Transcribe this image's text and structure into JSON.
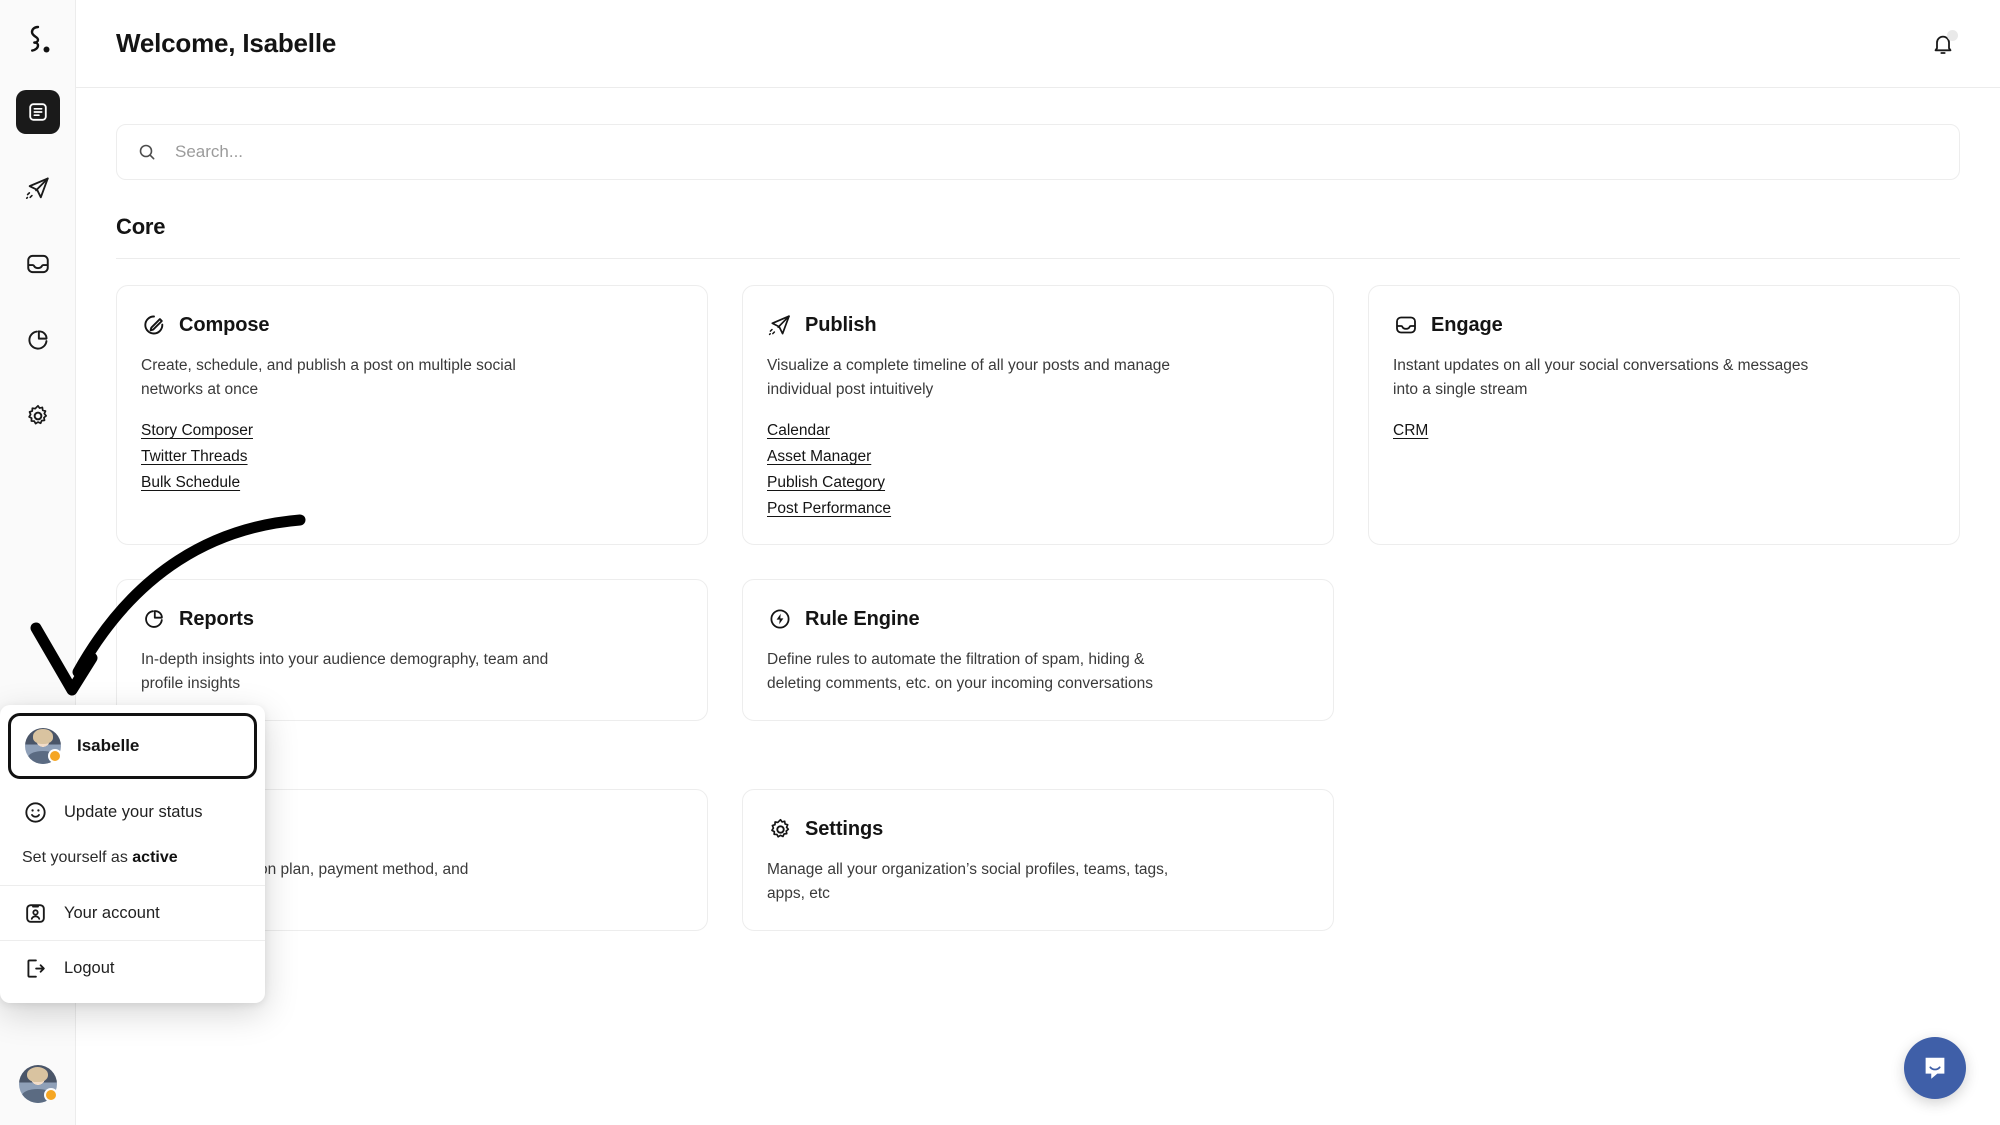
{
  "app": {
    "brand_logo": "contentstudio-logo-icon",
    "accent_color": "#3f5fa8",
    "active_nav_bg": "#1a1a1a"
  },
  "sidebar": {
    "items": [
      {
        "name": "dashboard",
        "icon": "dashboard-icon",
        "active": true
      },
      {
        "name": "publish",
        "icon": "paper-plane-icon",
        "active": false
      },
      {
        "name": "engage",
        "icon": "inbox-icon",
        "active": false
      },
      {
        "name": "reports",
        "icon": "pie-chart-icon",
        "active": false
      },
      {
        "name": "settings",
        "icon": "gear-icon",
        "active": false
      }
    ],
    "avatar_alt": "Isabelle"
  },
  "header": {
    "title": "Welcome, Isabelle",
    "notification_icon": "bell-icon"
  },
  "search": {
    "placeholder": "Search...",
    "value": "",
    "icon": "search-icon"
  },
  "sections": [
    {
      "title": "Core",
      "cards": [
        {
          "icon": "compose-pencil-icon",
          "title": "Compose",
          "description": "Create, schedule, and publish a post on multiple social networks at once",
          "links": [
            "Story Composer",
            "Twitter Threads",
            "Bulk Schedule"
          ]
        },
        {
          "icon": "paper-plane-icon",
          "title": "Publish",
          "description": "Visualize a complete timeline of all your posts and manage individual post intuitively",
          "links": [
            "Calendar",
            "Asset Manager",
            "Publish Category",
            "Post Performance"
          ]
        },
        {
          "icon": "inbox-icon",
          "title": "Engage",
          "description": "Instant updates on all your social conversations & messages into a single stream",
          "links": [
            "CRM"
          ]
        },
        {
          "icon": "pie-chart-icon",
          "title": "Reports",
          "description": "In-depth insights into your audience demography, team and profile insights",
          "links": []
        },
        {
          "icon": "rule-engine-bolt-icon",
          "title": "Rule Engine",
          "description": "Define rules to automate the filtration of spam, hiding & deleting comments, etc. on your incoming conversations",
          "links": []
        }
      ]
    },
    {
      "title": "",
      "cards": [
        {
          "icon": "billing-icon",
          "title": "",
          "description": "current subscription plan, payment method, and",
          "links": []
        },
        {
          "icon": "gear-icon",
          "title": "Settings",
          "description": "Manage all your organization’s social profiles, teams, tags, apps, etc",
          "links": []
        }
      ]
    }
  ],
  "user_menu": {
    "profile_name": "Isabelle",
    "update_status_label": "Update your status",
    "update_status_icon": "smiley-face-icon",
    "status_prefix": "Set yourself as ",
    "status_value": "active",
    "account_label": "Your account",
    "account_icon": "id-card-icon",
    "logout_label": "Logout",
    "logout_icon": "logout-arrow-icon"
  },
  "chat_widget": {
    "icon": "intercom-chat-icon",
    "color": "#3f5fa8"
  },
  "annotation": {
    "type": "curved-arrow",
    "points_to": "user-menu-profile-row"
  }
}
